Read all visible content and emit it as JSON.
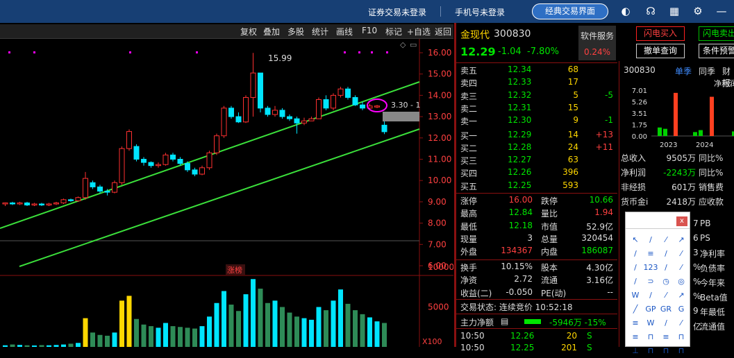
{
  "topbar": {
    "login_status": "证券交易未登录",
    "phone_status": "手机号未登录",
    "classic_button": "经典交易界面"
  },
  "toolbar": {
    "buttons": [
      "复权",
      "叠加",
      "多股",
      "统计",
      "画线",
      "F10",
      "标记",
      "+自选",
      "返回"
    ]
  },
  "kline": {
    "y_ticks": [
      "16.00",
      "15.00",
      "14.00",
      "13.00",
      "12.00",
      "11.00",
      "10.00",
      "9.00",
      "8.00",
      "7.00",
      "6.00"
    ],
    "high_label": "15.99",
    "cursor_label": "3.30 - 1",
    "badge": "涨榜",
    "colors": {
      "up": "#ff3030",
      "down": "#00e5ff",
      "trendline": "#3be03b",
      "volume_yellow": "#ffd700",
      "magenta": "#ff00ff"
    },
    "candles": [
      [
        8.9,
        8.95,
        8.8,
        8.97
      ],
      [
        8.95,
        8.9,
        8.85,
        9.0
      ],
      [
        8.9,
        8.95,
        8.85,
        9.0
      ],
      [
        8.95,
        8.85,
        8.8,
        9.0
      ],
      [
        8.85,
        8.9,
        8.8,
        8.95
      ],
      [
        8.9,
        8.85,
        8.8,
        8.95
      ],
      [
        8.85,
        8.9,
        8.8,
        8.95
      ],
      [
        8.9,
        8.95,
        8.85,
        9.0
      ],
      [
        8.95,
        9.1,
        8.9,
        9.15
      ],
      [
        9.1,
        9.05,
        9.0,
        9.15
      ],
      [
        9.05,
        9.2,
        9.0,
        9.25
      ],
      [
        9.2,
        10.1,
        9.1,
        10.4
      ],
      [
        9.9,
        9.7,
        9.6,
        10.0
      ],
      [
        9.7,
        9.5,
        9.4,
        9.8
      ],
      [
        9.5,
        9.45,
        9.3,
        9.6
      ],
      [
        9.45,
        9.9,
        9.4,
        10.0
      ],
      [
        9.9,
        11.5,
        9.8,
        11.6
      ],
      [
        11.5,
        12.3,
        11.4,
        12.4
      ],
      [
        11.6,
        11.0,
        10.9,
        11.7
      ],
      [
        11.0,
        10.85,
        10.7,
        11.1
      ],
      [
        10.85,
        10.7,
        10.6,
        10.9
      ],
      [
        10.7,
        10.75,
        10.6,
        10.85
      ],
      [
        10.75,
        11.2,
        10.7,
        11.3
      ],
      [
        11.2,
        11.0,
        10.9,
        11.3
      ],
      [
        11.0,
        10.8,
        10.7,
        11.1
      ],
      [
        10.8,
        10.5,
        10.4,
        10.9
      ],
      [
        10.5,
        10.3,
        10.2,
        10.6
      ],
      [
        10.3,
        10.6,
        10.25,
        10.7
      ],
      [
        10.6,
        11.3,
        10.5,
        11.4
      ],
      [
        11.3,
        12.1,
        11.2,
        12.2
      ],
      [
        12.1,
        13.4,
        12.0,
        13.5
      ],
      [
        13.4,
        13.0,
        12.9,
        13.5
      ],
      [
        13.0,
        12.75,
        12.7,
        13.2
      ],
      [
        12.75,
        13.9,
        12.7,
        14.0
      ],
      [
        13.9,
        15.05,
        13.0,
        15.99
      ],
      [
        15.05,
        13.4,
        13.2,
        14.0
      ],
      [
        13.4,
        13.1,
        13.0,
        13.5
      ],
      [
        13.1,
        13.3,
        13.0,
        13.5
      ],
      [
        13.3,
        13.0,
        12.9,
        13.4
      ],
      [
        13.0,
        12.9,
        12.8,
        13.1
      ],
      [
        12.9,
        12.7,
        12.2,
        13.0
      ],
      [
        12.7,
        12.8,
        12.6,
        12.95
      ],
      [
        12.8,
        12.9,
        12.8,
        13.0
      ],
      [
        12.9,
        13.8,
        12.9,
        13.9
      ],
      [
        13.8,
        13.4,
        13.3,
        14.0
      ],
      [
        13.4,
        14.0,
        13.3,
        14.1
      ],
      [
        14.0,
        14.3,
        13.9,
        14.4
      ],
      [
        14.3,
        13.9,
        13.8,
        14.4
      ],
      [
        13.9,
        13.55,
        13.5,
        14.0
      ],
      [
        13.55,
        13.4,
        13.3,
        13.7
      ],
      [
        13.4,
        13.5,
        13.3,
        13.6
      ],
      [
        13.45,
        13.5,
        13.4,
        13.55
      ],
      [
        12.6,
        12.29,
        12.18,
        12.84
      ]
    ],
    "vol_ticks": [
      "10000",
      "5000",
      "X100"
    ],
    "volumes": [
      200,
      300,
      250,
      200,
      180,
      220,
      200,
      240,
      300,
      400,
      500,
      3600,
      1800,
      1500,
      1400,
      1800,
      5800,
      6400,
      3500,
      2800,
      2600,
      2400,
      3000,
      2600,
      2500,
      2400,
      2300,
      2600,
      3800,
      5500,
      7000,
      5300,
      4500,
      6600,
      8500,
      7300,
      5500,
      5800,
      5000,
      4300,
      3800,
      3600,
      3400,
      5000,
      4600,
      5800,
      7200,
      5400,
      4600,
      4100,
      3700,
      3200,
      3000
    ]
  },
  "quote": {
    "name": "金现代",
    "code": "300830",
    "price": "12.29",
    "change": "-1.04",
    "pct": "-7.80%",
    "service_label": "软件服务",
    "service_pct": "0.24%",
    "asks": [
      [
        "卖五",
        "12.34",
        "68",
        ""
      ],
      [
        "卖四",
        "12.33",
        "17",
        ""
      ],
      [
        "卖三",
        "12.32",
        "5",
        "-5"
      ],
      [
        "卖二",
        "12.31",
        "15",
        ""
      ],
      [
        "卖一",
        "12.30",
        "9",
        "-1"
      ]
    ],
    "bids": [
      [
        "买一",
        "12.29",
        "14",
        "+13"
      ],
      [
        "买二",
        "12.28",
        "24",
        "+11"
      ],
      [
        "买三",
        "12.27",
        "63",
        ""
      ],
      [
        "买四",
        "12.26",
        "396",
        ""
      ],
      [
        "买五",
        "12.25",
        "593",
        ""
      ]
    ],
    "stats": [
      [
        "涨停",
        "16.00",
        "跌停",
        "10.66"
      ],
      [
        "最高",
        "12.84",
        "量比",
        "1.94"
      ],
      [
        "最低",
        "12.18",
        "市值",
        "52.9亿"
      ],
      [
        "现量",
        "3",
        "总量",
        "320454"
      ],
      [
        "外盘",
        "134367",
        "内盘",
        "186087"
      ]
    ],
    "stats2": [
      [
        "换手",
        "10.15%",
        "股本",
        "4.30亿"
      ],
      [
        "净资",
        "2.72",
        "流通",
        "3.16亿"
      ],
      [
        "收益(二)",
        "-0.050",
        "PE(动)",
        "--"
      ]
    ],
    "trade_status": "交易状态: 连续竞价 10:52:18",
    "main_net_label": "主力净额",
    "main_net": "-5946万 -15%",
    "ticks": [
      [
        "10:50",
        "12.26",
        "20",
        "S"
      ],
      [
        "10:50",
        "12.25",
        "201",
        "S"
      ]
    ]
  },
  "buttons": {
    "flash_buy": "闪电买入",
    "flash_sell": "闪电卖出",
    "cancel_query": "撤单查询",
    "condition_warn": "条件预警"
  },
  "fin": {
    "code": "300830",
    "tabs": [
      "单季",
      "同季",
      "财报"
    ],
    "chart_title": "净利润",
    "y_ticks": [
      "7.01",
      "5.26",
      "3.51",
      "1.75",
      "0.00"
    ],
    "years": [
      "2023",
      "2024"
    ],
    "bars": [
      {
        "v": 1.3,
        "c": "g"
      },
      {
        "v": 1.1,
        "c": "g"
      },
      {
        "v": 6.6,
        "c": "r"
      },
      {
        "v": 0.6,
        "c": "g"
      },
      {
        "v": 0.9,
        "c": "g"
      },
      {
        "v": 6.0,
        "c": "r"
      },
      {
        "v": 0.7,
        "c": "g"
      }
    ],
    "rows": [
      [
        "总收入",
        "9505万",
        "同比%"
      ],
      [
        "净利润",
        "-2243万",
        "同比%"
      ],
      [
        "非经损",
        "601万",
        "销售费"
      ],
      [
        "货币金i",
        "2418万",
        "应收款"
      ]
    ],
    "partial_right": [
      "PB",
      "PS",
      "净利率",
      "负债率",
      "今年来",
      "Beta值",
      "年最低",
      "流通值"
    ],
    "partial_left": [
      "7",
      "6",
      "3",
      "%",
      "%",
      "%",
      "9",
      "亿"
    ]
  },
  "palette": {
    "close": "x",
    "tools": [
      "↖",
      "/",
      "⁄",
      "↗",
      "/",
      "≡",
      "/",
      "⁄",
      "/",
      "123",
      "/",
      "⁄",
      "/",
      "⊃",
      "◷",
      "◎",
      "W",
      "/",
      "⁄",
      "↗",
      "╱",
      "GP",
      "GR",
      "G",
      "≡",
      "W",
      "/",
      "⁄",
      "≡",
      "⊓",
      "≡",
      "⊓",
      "⊥",
      "⊓",
      "⊓",
      "⊓"
    ]
  }
}
